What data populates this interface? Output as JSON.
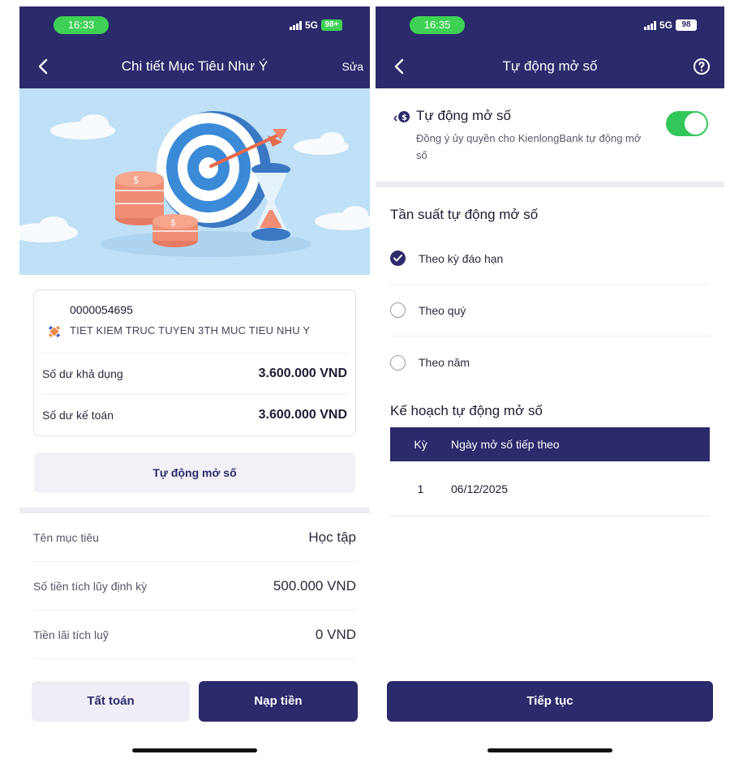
{
  "left_screen": {
    "status": {
      "time": "16:33",
      "network": "5G",
      "battery": "98+"
    },
    "nav": {
      "title": "Chi tiết Mục Tiêu Như Ý",
      "action": "Sửa"
    },
    "account": {
      "number": "0000054695",
      "name": "TIET KIEM TRUC TUYEN 3TH MUC TIEU NHU Y",
      "rows": [
        {
          "label": "Số dư khả dụng",
          "value": "3.600.000 VND"
        },
        {
          "label": "Số dư kế toán",
          "value": "3.600.000 VND"
        }
      ]
    },
    "auto_open_button": "Tự động mở số",
    "info_rows": [
      {
        "label": "Tên mục tiêu",
        "value": "Học tập"
      },
      {
        "label": "Số tiền tích lũy định kỳ",
        "value": "500.000 VND"
      },
      {
        "label": "Tiền lãi tích luỹ",
        "value": "0 VND"
      }
    ],
    "buttons": {
      "settle": "Tất toán",
      "deposit": "Nạp tiền"
    }
  },
  "right_screen": {
    "status": {
      "time": "16:35",
      "network": "5G",
      "battery": "98"
    },
    "nav": {
      "title": "Tự động mở số"
    },
    "auto_open": {
      "title": "Tự động mở số",
      "description": "Đồng ý ủy quyền cho KienlongBank tự động mở số",
      "enabled": true
    },
    "frequency": {
      "title": "Tần suất tự động mở số",
      "options": [
        {
          "label": "Theo kỳ đáo hạn",
          "selected": true
        },
        {
          "label": "Theo quý",
          "selected": false
        },
        {
          "label": "Theo năm",
          "selected": false
        }
      ]
    },
    "plan": {
      "title": "Kế hoạch tự động mở số",
      "columns": [
        "Kỳ",
        "Ngày mở số tiếp theo"
      ],
      "rows": [
        {
          "ky": "1",
          "date": "06/12/2025"
        }
      ]
    },
    "continue_button": "Tiếp tục"
  },
  "colors": {
    "primary": "#2b2a6b",
    "status_green": "#3fd155",
    "toggle_green": "#33c759",
    "hero_bg": "#bfe0f7"
  }
}
